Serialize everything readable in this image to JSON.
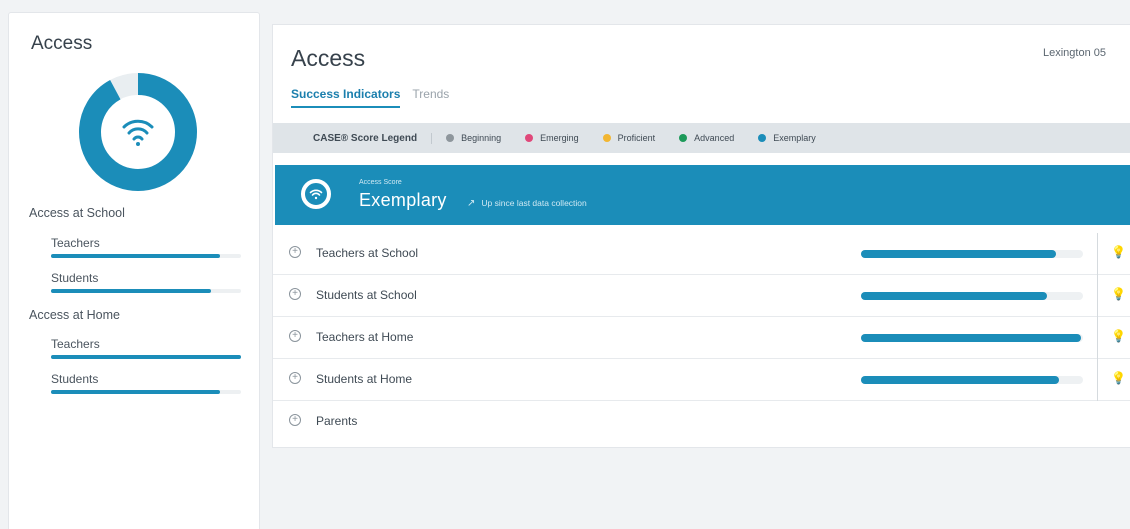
{
  "sidebar": {
    "title": "Access",
    "donut_fraction": 0.92,
    "groups": [
      {
        "label": "Access at School",
        "items": [
          {
            "label": "Teachers",
            "fraction": 0.89
          },
          {
            "label": "Students",
            "fraction": 0.84
          }
        ]
      },
      {
        "label": "Access at Home",
        "items": [
          {
            "label": "Teachers",
            "fraction": 1.0
          },
          {
            "label": "Students",
            "fraction": 0.89
          }
        ]
      }
    ]
  },
  "main": {
    "title": "Access",
    "school": "Lexington 05",
    "tabs": [
      {
        "label": "Success Indicators",
        "active": true
      },
      {
        "label": "Trends",
        "active": false
      }
    ],
    "legend": {
      "title": "CASE® Score Legend",
      "items": [
        {
          "label": "Beginning",
          "color": "#8e969c"
        },
        {
          "label": "Emerging",
          "color": "#e0487a"
        },
        {
          "label": "Proficient",
          "color": "#f2b632"
        },
        {
          "label": "Advanced",
          "color": "#1d9a5a"
        },
        {
          "label": "Exemplary",
          "color": "#1b8db9"
        }
      ]
    },
    "banner": {
      "small_label": "Access Score",
      "score": "Exemplary",
      "trend": "Up since last data collection",
      "color": "#1b8db9"
    },
    "rows": [
      {
        "label": "Teachers at School",
        "fraction": 0.88,
        "has_bar": true
      },
      {
        "label": "Students at School",
        "fraction": 0.84,
        "has_bar": true
      },
      {
        "label": "Teachers at Home",
        "fraction": 0.99,
        "has_bar": true
      },
      {
        "label": "Students at Home",
        "fraction": 0.89,
        "has_bar": true
      },
      {
        "label": "Parents",
        "has_bar": false
      }
    ]
  }
}
